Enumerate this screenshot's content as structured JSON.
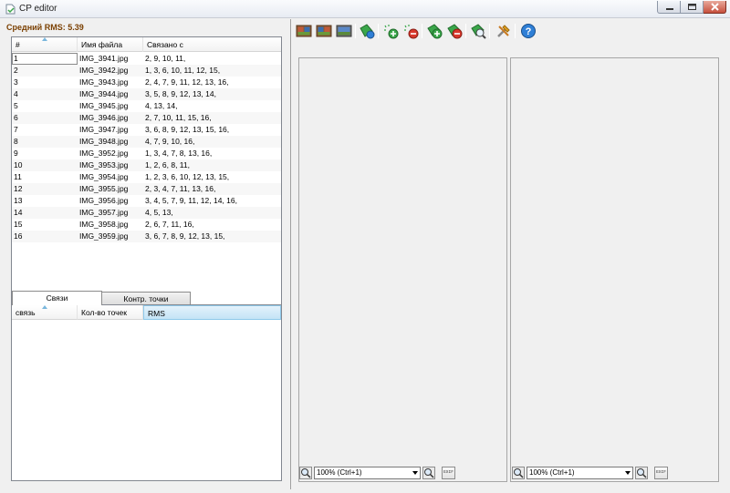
{
  "window": {
    "title": "CP editor"
  },
  "summary": {
    "rms_label": "Средний RMS: 5.39"
  },
  "files_table": {
    "columns": [
      "#",
      "Имя файла",
      "Связано с"
    ],
    "rows": [
      {
        "n": "1",
        "file": "IMG_3941.jpg",
        "links": "2, 9, 10, 11,"
      },
      {
        "n": "2",
        "file": "IMG_3942.jpg",
        "links": "1, 3, 6, 10, 11, 12, 15,"
      },
      {
        "n": "3",
        "file": "IMG_3943.jpg",
        "links": "2, 4, 7, 9, 11, 12, 13, 16,"
      },
      {
        "n": "4",
        "file": "IMG_3944.jpg",
        "links": "3, 5, 8, 9, 12, 13, 14,"
      },
      {
        "n": "5",
        "file": "IMG_3945.jpg",
        "links": "4, 13, 14,"
      },
      {
        "n": "6",
        "file": "IMG_3946.jpg",
        "links": "2, 7, 10, 11, 15, 16,"
      },
      {
        "n": "7",
        "file": "IMG_3947.jpg",
        "links": "3, 6, 8, 9, 12, 13, 15, 16,"
      },
      {
        "n": "8",
        "file": "IMG_3948.jpg",
        "links": "4, 7, 9, 10, 16,"
      },
      {
        "n": "9",
        "file": "IMG_3952.jpg",
        "links": "1, 3, 4, 7, 8, 13, 16,"
      },
      {
        "n": "10",
        "file": "IMG_3953.jpg",
        "links": "1, 2, 6, 8, 11,"
      },
      {
        "n": "11",
        "file": "IMG_3954.jpg",
        "links": "1, 2, 3, 6, 10, 12, 13, 15,"
      },
      {
        "n": "12",
        "file": "IMG_3955.jpg",
        "links": "2, 3, 4, 7, 11, 13, 16,"
      },
      {
        "n": "13",
        "file": "IMG_3956.jpg",
        "links": "3, 4, 5, 7, 9, 11, 12, 14, 16,"
      },
      {
        "n": "14",
        "file": "IMG_3957.jpg",
        "links": "4, 5, 13,"
      },
      {
        "n": "15",
        "file": "IMG_3958.jpg",
        "links": "2, 6, 7, 11, 16,"
      },
      {
        "n": "16",
        "file": "IMG_3959.jpg",
        "links": "3, 6, 7, 8, 9, 12, 13, 15,"
      }
    ]
  },
  "tabs": [
    {
      "label": "Связи",
      "active": true
    },
    {
      "label": "Контр. точки",
      "active": false
    }
  ],
  "links_table": {
    "columns": [
      "связь",
      "Кол-во точек",
      "RMS"
    ]
  },
  "toolbar": {
    "buttons": [
      "open-images-icon",
      "open-pair-left-icon",
      "open-pair-right-icon",
      "optimize-icon",
      "add-points-icon",
      "remove-points-icon",
      "add-link-icon",
      "remove-link-icon",
      "find-points-icon",
      "settings-icon",
      "help-icon"
    ]
  },
  "viewers": [
    {
      "zoom": "100% (Ctrl+1)",
      "exif_label": "EXIF"
    },
    {
      "zoom": "100% (Ctrl+1)",
      "exif_label": "EXIF"
    }
  ],
  "colors": {
    "rms_text": "#7a3f00",
    "header_highlight": "#c4e4f6",
    "accent_green": "#3aa64a",
    "help_blue": "#2f7fd6"
  }
}
